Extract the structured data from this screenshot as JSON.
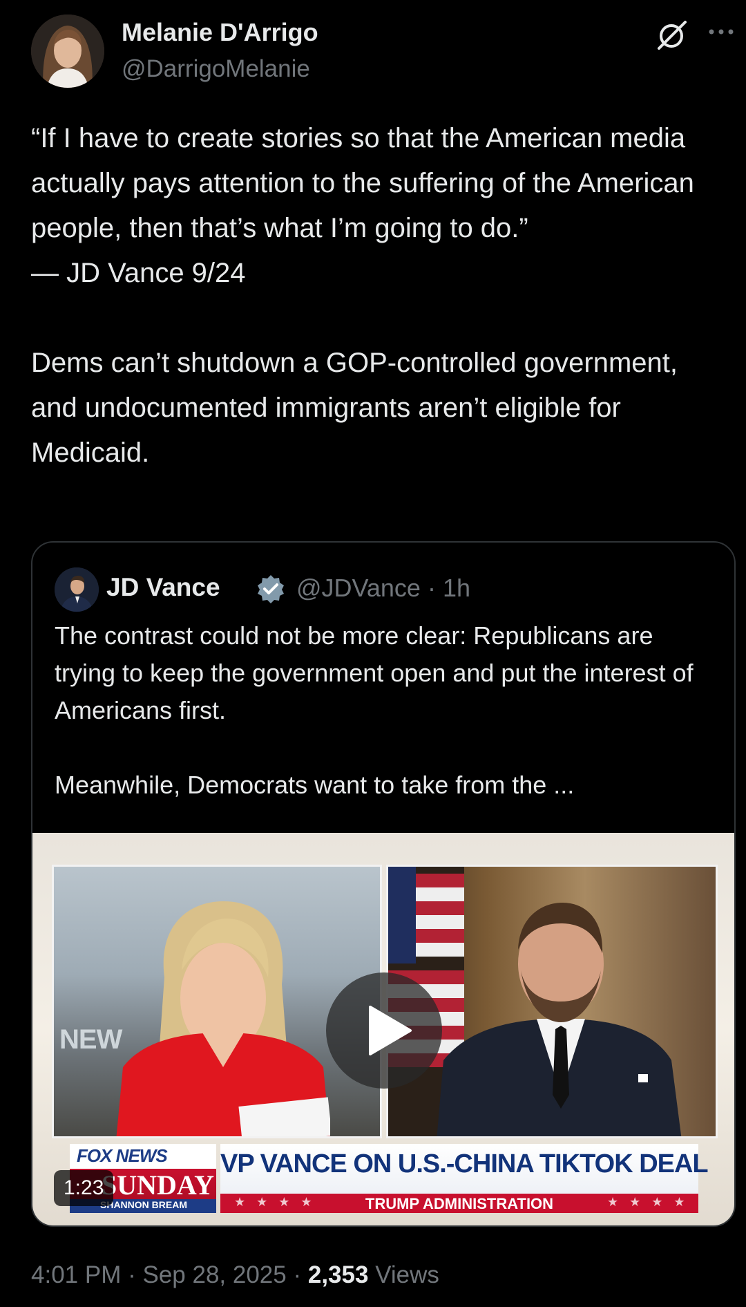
{
  "author": {
    "name": "Melanie D'Arrigo",
    "handle": "@DarrigoMelanie"
  },
  "tweet": {
    "quote_lines": [
      "“If I have to create stories so that the American media actually pays attention to the suffering of the American people, then that’s what I’m going to do.”",
      "— JD Vance 9/24"
    ],
    "body": "Dems can’t shutdown a GOP-controlled government, and undocumented immigrants aren’t eligible for Medicaid."
  },
  "quoted_tweet": {
    "name": "JD Vance",
    "handle": "@JDVance",
    "separator": "·",
    "time": "1h",
    "text_para1": "The contrast could not be more clear: Republicans are trying to keep the government open and put the interest of Americans first.",
    "text_para2": "Meanwhile, Democrats want to take from the ...",
    "video": {
      "duration": "1:23",
      "overlay_new": "NEW",
      "network_logo": "FOX NEWS",
      "show_name": "SUNDAY",
      "host": "SHANNON BREAM",
      "headline": "VP VANCE ON U.S.-CHINA TIKTOK DEAL",
      "subheadline": "TRUMP ADMINISTRATION",
      "stars": "★★★★"
    }
  },
  "meta": {
    "time": "4:01 PM",
    "separator": "·",
    "date": "Sep 28, 2025",
    "views_count": "2,353",
    "views_label": "Views"
  },
  "icons": {
    "grok": "grok-icon",
    "more": "more-icon",
    "verified": "verified-badge-icon",
    "play": "play-icon"
  },
  "colors": {
    "background": "#000000",
    "text_primary": "#e7e9ea",
    "text_secondary": "#71767b",
    "border": "#2f3336",
    "fox_red": "#c8102e",
    "fox_blue": "#12337a"
  }
}
